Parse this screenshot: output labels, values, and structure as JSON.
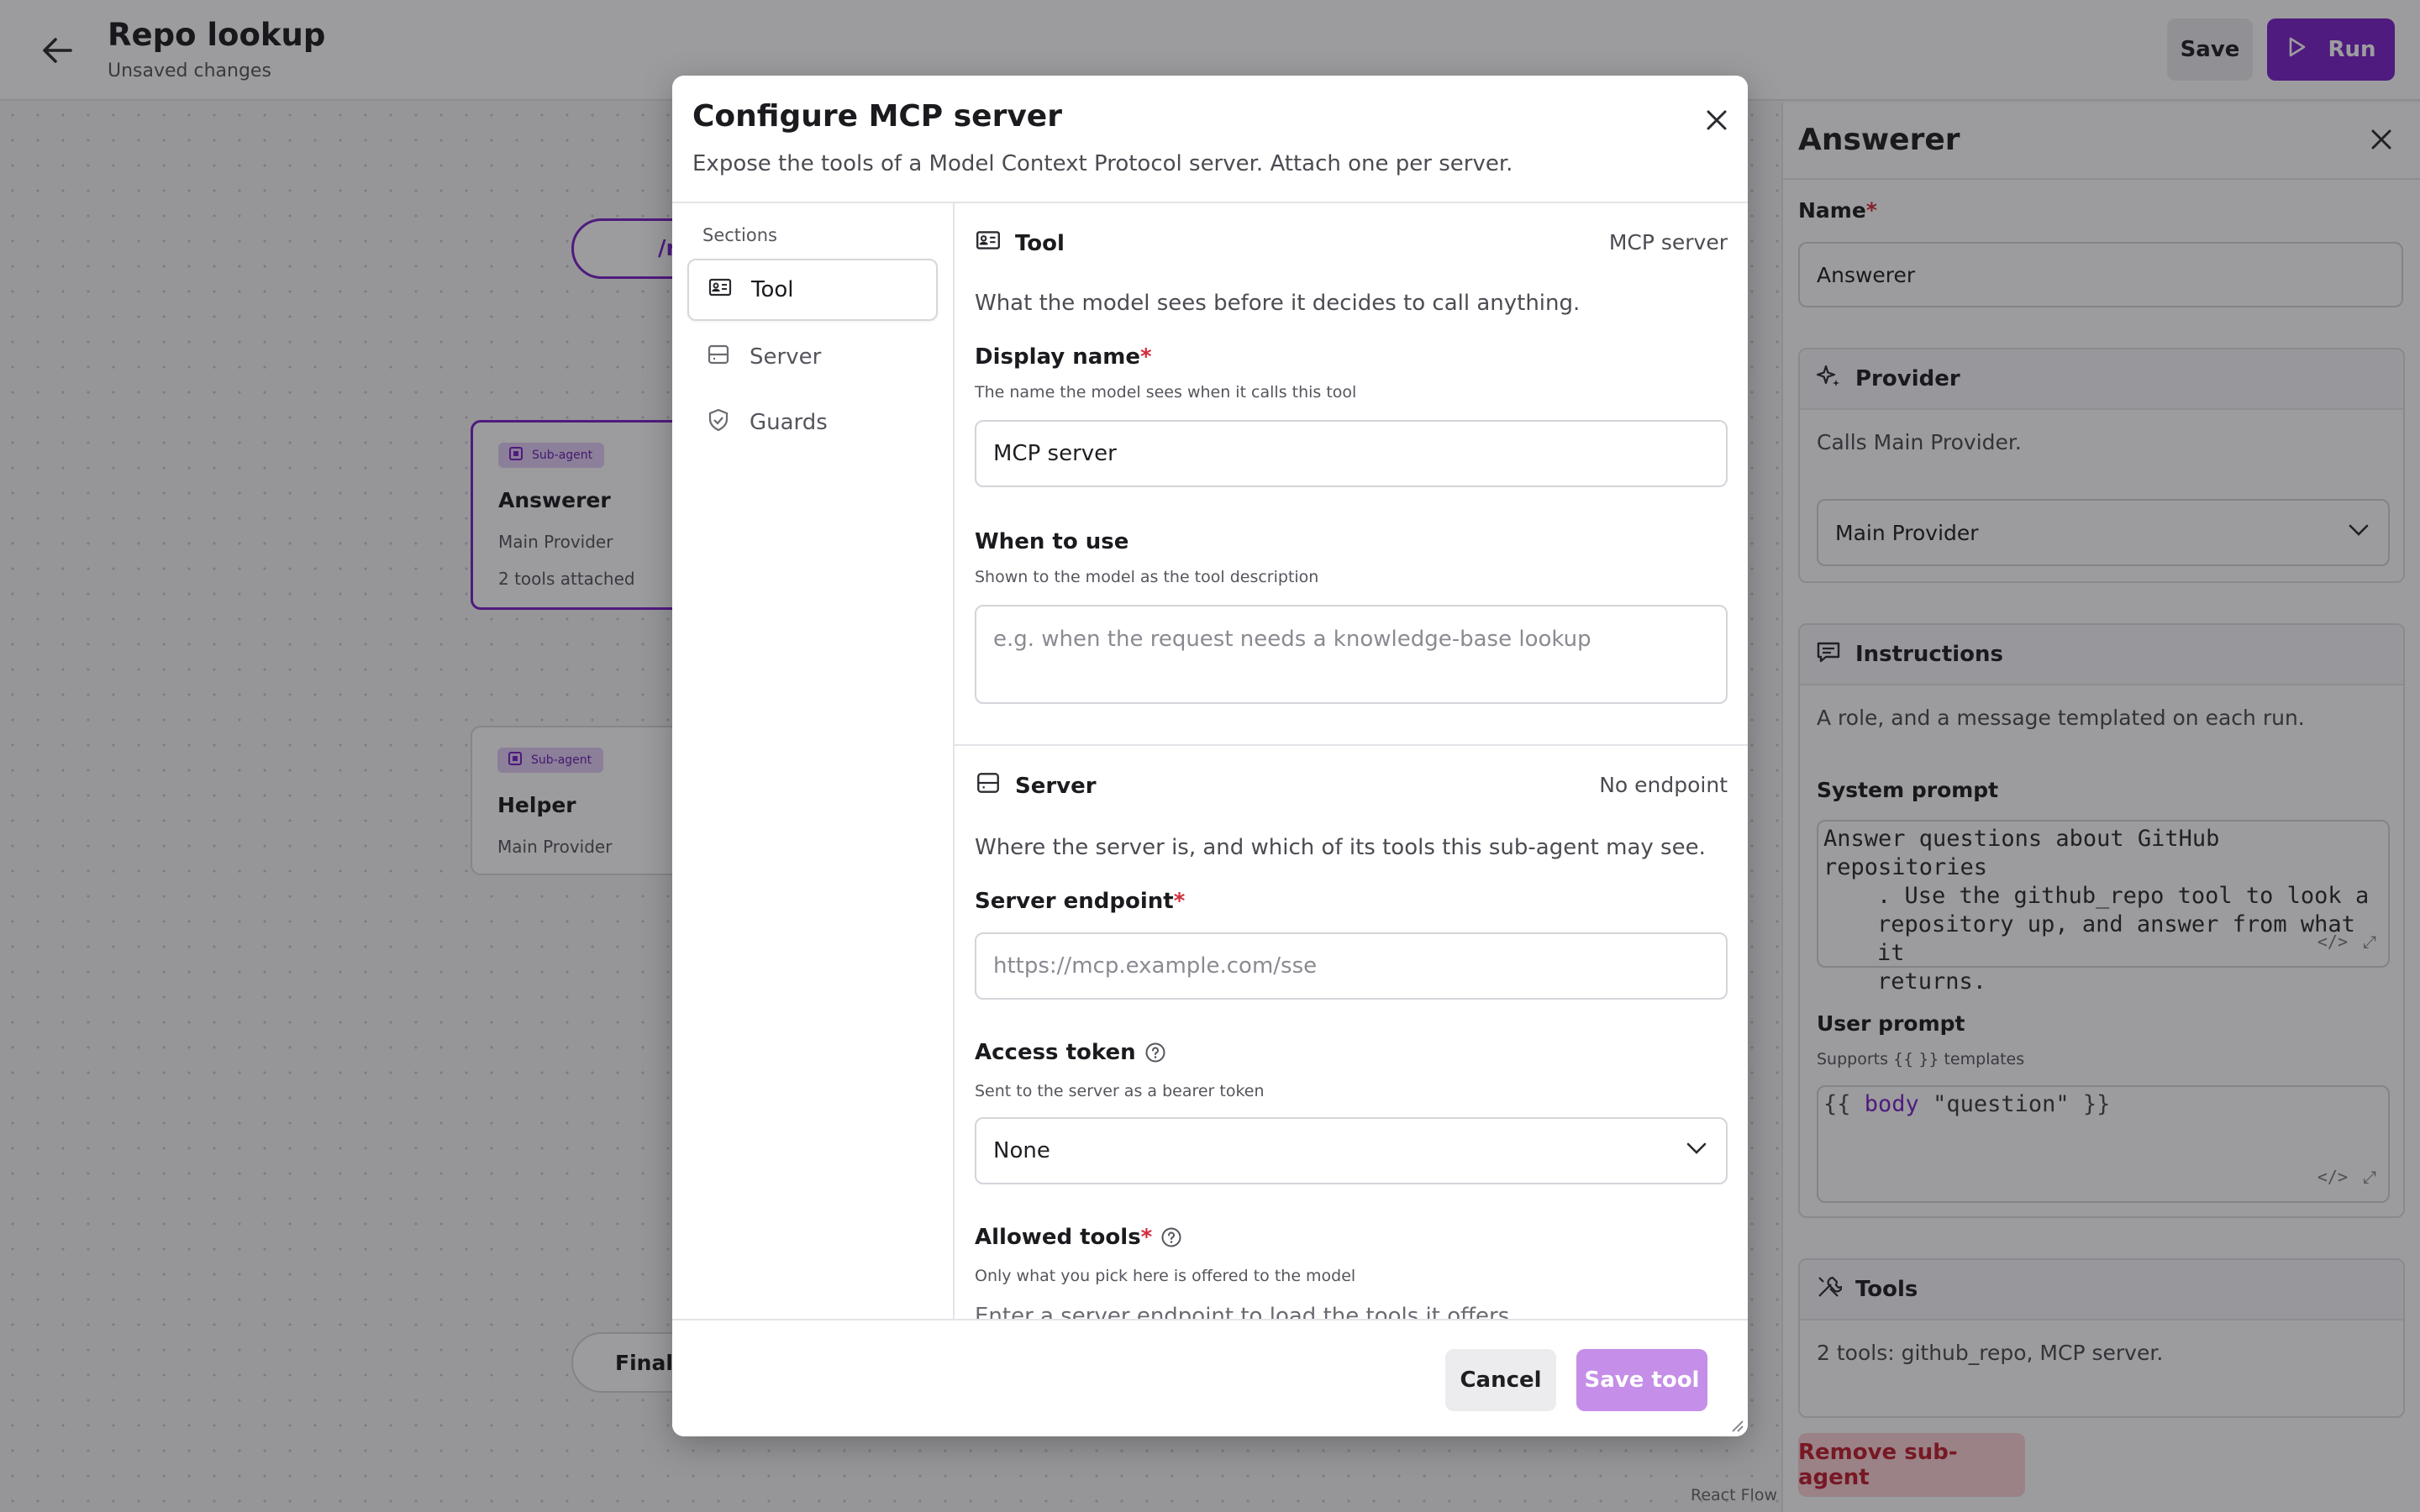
{
  "header": {
    "title": "Repo lookup",
    "subtitle": "Unsaved changes",
    "save_label": "Save",
    "run_label": "Run"
  },
  "canvas": {
    "trigger_pill_text": "/r",
    "final_pill_text": "Final r",
    "nodes": [
      {
        "tag": "Sub-agent",
        "title": "Answerer",
        "provider": "Main Provider",
        "tools": "2 tools attached"
      },
      {
        "tag": "Sub-agent",
        "title": "Helper",
        "provider": "Main Provider"
      }
    ],
    "watermark": "React Flow"
  },
  "side_panel": {
    "title": "Answerer",
    "name_label": "Name",
    "name_value": "Answerer",
    "provider": {
      "title": "Provider",
      "description": "Calls Main Provider.",
      "selected": "Main Provider"
    },
    "instructions": {
      "title": "Instructions",
      "description": "A role, and a message templated on each run.",
      "system_prompt_label": "System prompt",
      "system_prompt_lines": [
        "Answer questions about GitHub repositories",
        ". Use the github_repo tool to look a",
        "repository up, and answer from what it",
        "returns."
      ],
      "user_prompt_label": "User prompt",
      "user_prompt_hint": "Supports {{ }} templates",
      "user_prompt_open": "{{",
      "user_prompt_var": "body",
      "user_prompt_str": "\"question\"",
      "user_prompt_close": "}}"
    },
    "tools": {
      "title": "Tools",
      "description": "2 tools: github_repo, MCP server."
    },
    "remove_label": "Remove sub-agent"
  },
  "modal": {
    "title": "Configure MCP server",
    "description": "Expose the tools of a Model Context Protocol server. Attach one per server.",
    "sections_label": "Sections",
    "nav": [
      {
        "label": "Tool",
        "icon": "id-card-icon"
      },
      {
        "label": "Server",
        "icon": "server-icon"
      },
      {
        "label": "Guards",
        "icon": "shield-check-icon"
      }
    ],
    "tool_section": {
      "title": "Tool",
      "right": "MCP server",
      "description": "What the model sees before it decides to call anything.",
      "display_name_label": "Display name",
      "display_name_hint": "The name the model sees when it calls this tool",
      "display_name_value": "MCP server",
      "when_label": "When to use",
      "when_hint": "Shown to the model as the tool description",
      "when_placeholder": "e.g. when the request needs a knowledge-base lookup"
    },
    "server_section": {
      "title": "Server",
      "right": "No endpoint",
      "description": "Where the server is, and which of its tools this sub-agent may see.",
      "endpoint_label": "Server endpoint",
      "endpoint_placeholder": "https://mcp.example.com/sse",
      "token_label": "Access token",
      "token_hint": "Sent to the server as a bearer token",
      "token_value": "None",
      "allowed_label": "Allowed tools",
      "allowed_hint": "Only what you pick here is offered to the model",
      "allowed_empty": "Enter a server endpoint to load the tools it offers."
    },
    "cancel_label": "Cancel",
    "save_label": "Save tool"
  },
  "colors": {
    "accent": "#7a22c8",
    "accent_disabled": "#c58ee8",
    "danger": "#c01c2e",
    "required": "#d52b3d"
  }
}
